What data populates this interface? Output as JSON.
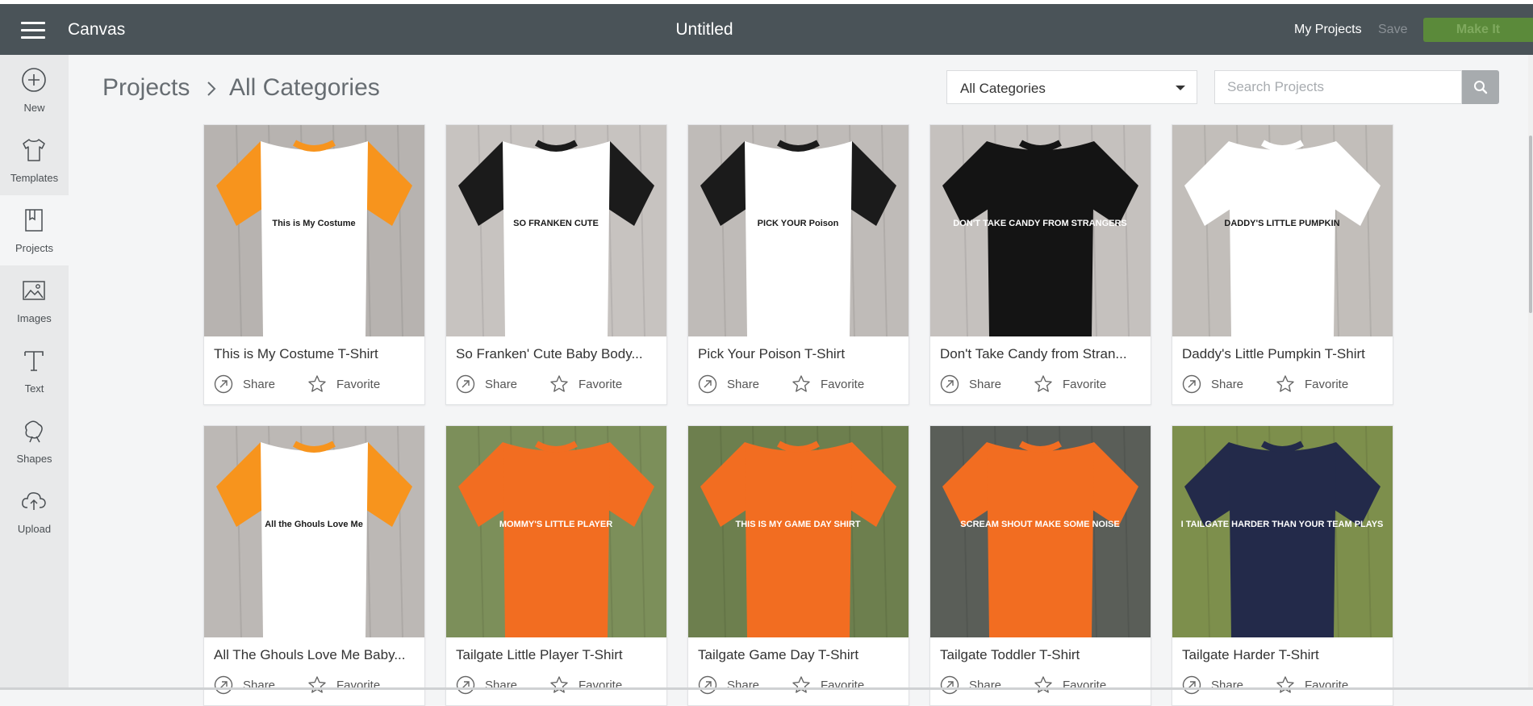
{
  "header": {
    "brand": "Canvas",
    "doc_title": "Untitled",
    "my_projects": "My Projects",
    "save": "Save",
    "make_it": "Make It"
  },
  "sidebar": {
    "items": [
      {
        "label": "New",
        "icon": "plus-circle-icon"
      },
      {
        "label": "Templates",
        "icon": "tshirt-icon"
      },
      {
        "label": "Projects",
        "icon": "projects-icon"
      },
      {
        "label": "Images",
        "icon": "image-icon"
      },
      {
        "label": "Text",
        "icon": "text-icon"
      },
      {
        "label": "Shapes",
        "icon": "shapes-icon"
      },
      {
        "label": "Upload",
        "icon": "upload-cloud-icon"
      }
    ]
  },
  "breadcrumb": {
    "root": "Projects",
    "current": "All Categories"
  },
  "filter": {
    "selected": "All Categories"
  },
  "search": {
    "placeholder": "Search Projects"
  },
  "actions": {
    "share": "Share",
    "favorite": "Favorite"
  },
  "projects": [
    {
      "title": "This is My Costume T-Shirt",
      "shirt_color": "#ffffff",
      "sleeve_color": "#f7941d",
      "bg": "#b7b3b0",
      "print": "This is My Costume"
    },
    {
      "title": "So Franken' Cute Baby Body...",
      "shirt_color": "#ffffff",
      "sleeve_color": "#1b1b1b",
      "bg": "#c7c3c0",
      "print": "SO FRANKEN CUTE"
    },
    {
      "title": "Pick Your Poison T-Shirt",
      "shirt_color": "#ffffff",
      "sleeve_color": "#1b1b1b",
      "bg": "#bfbbb8",
      "print": "PICK YOUR Poison"
    },
    {
      "title": "Don't Take Candy from Stran...",
      "shirt_color": "#141414",
      "sleeve_color": "#141414",
      "bg": "#c5c1be",
      "print": "DON'T TAKE CANDY FROM STRANGERS"
    },
    {
      "title": "Daddy's Little Pumpkin T-Shirt",
      "shirt_color": "#ffffff",
      "sleeve_color": "#ffffff",
      "bg": "#c2beba",
      "print": "DADDY'S LITTLE PUMPKIN"
    },
    {
      "title": "All The Ghouls Love Me Baby...",
      "shirt_color": "#ffffff",
      "sleeve_color": "#f7941d",
      "bg": "#bcb8b5",
      "print": "All the Ghouls Love Me"
    },
    {
      "title": "Tailgate Little Player T-Shirt",
      "shirt_color": "#f26d21",
      "sleeve_color": "#f26d21",
      "bg": "#7c8f5a",
      "print": "MOMMY'S LITTLE PLAYER"
    },
    {
      "title": "Tailgate Game Day T-Shirt",
      "shirt_color": "#f26d21",
      "sleeve_color": "#f26d21",
      "bg": "#6d7f4e",
      "print": "THIS IS MY GAME DAY SHIRT"
    },
    {
      "title": "Tailgate Toddler T-Shirt",
      "shirt_color": "#f26d21",
      "sleeve_color": "#f26d21",
      "bg": "#5a5e58",
      "print": "SCREAM SHOUT MAKE SOME NOISE"
    },
    {
      "title": "Tailgate Harder T-Shirt",
      "shirt_color": "#232a4a",
      "sleeve_color": "#232a4a",
      "bg": "#7d8f4c",
      "print": "I TAILGATE HARDER THAN YOUR TEAM PLAYS"
    }
  ]
}
